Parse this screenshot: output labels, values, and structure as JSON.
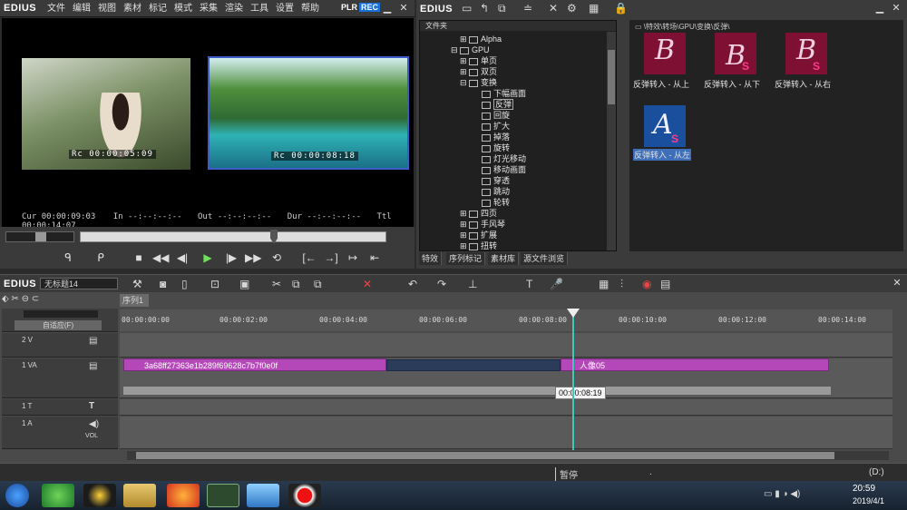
{
  "player": {
    "logo": "EDIUS",
    "menu": [
      "文件",
      "编辑",
      "视图",
      "素材",
      "标记",
      "模式",
      "采集",
      "渲染",
      "工具",
      "设置",
      "帮助"
    ],
    "plr": "PLR",
    "rec": "REC",
    "left_tc": "00:00:05:09",
    "right_tc": "00:00:08:18",
    "rc": "Rc",
    "cur_label": "Cur",
    "cur_val": "00:00:09:03",
    "in_label": "In",
    "in_val": "--:--:--:--",
    "out_label": "Out",
    "out_val": "--:--:--:--",
    "dur_label": "Dur",
    "dur_val": "--:--:--:--",
    "ttl_label": "Ttl",
    "ttl_val": "00:00:14:07"
  },
  "bin": {
    "logo": "EDIUS",
    "folder_header": "文件夹",
    "path": "\\特效\\转场\\GPU\\变换\\反弹\\",
    "tree": [
      "Alpha",
      "GPU",
      "单页",
      "双页",
      "变换",
      "下幅画面",
      "反弹",
      "回旋",
      "扩大",
      "掉落",
      "旋转",
      "灯光移动",
      "移动画面",
      "穿透",
      "跳动",
      "轮转",
      "四页",
      "手风琴",
      "扩展",
      "扭转",
      "折叠"
    ],
    "tabs": [
      "特效",
      "序列标记",
      "素材库",
      "源文件浏览"
    ],
    "clips": [
      {
        "label": "反弹转入 - 从上",
        "a": "B",
        "b": "S"
      },
      {
        "label": "反弹转入 - 从下",
        "a": "B",
        "b": "S"
      },
      {
        "label": "反弹转入 - 从右",
        "a": "B",
        "b": "S"
      },
      {
        "label": "反弹转入 - 从左",
        "a": "A",
        "b": "S"
      }
    ]
  },
  "timeline": {
    "logo": "EDIUS",
    "project": "无标题14",
    "sequence_tab": "序列1",
    "fit": "自适应(F)",
    "ruler": [
      "00:00:00:00",
      "00:00:02:00",
      "00:00:04:00",
      "00:00:06:00",
      "00:00:08:00",
      "00:00:10:00",
      "00:00:12:00",
      "00:00:14:00"
    ],
    "tracks": [
      "2 V",
      "1 VA",
      "1 T",
      "1 A"
    ],
    "vol": "VOL",
    "clip1": "3a68ff27363e1b289f69628c7b7f0e0f",
    "clip2": "人像05",
    "tooltip": "00:00:08:19"
  },
  "status": {
    "state": "暂停",
    "dot": ".",
    "disk": "(D:)"
  },
  "taskbar": {
    "time": "20:59",
    "date": "2019/4/1"
  }
}
